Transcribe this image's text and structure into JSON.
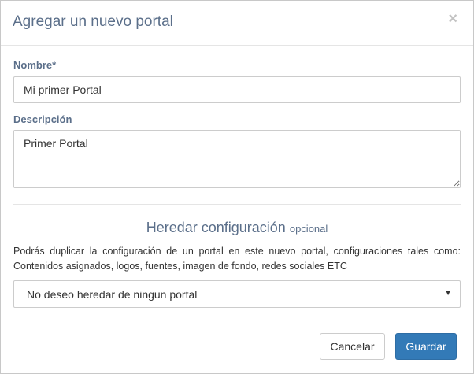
{
  "modal": {
    "title": "Agregar un nuevo portal",
    "close_symbol": "×"
  },
  "form": {
    "name_label": "Nombre*",
    "name_value": "Mi primer Portal",
    "description_label": "Descripción",
    "description_value": "Primer Portal"
  },
  "inherit": {
    "heading": "Heredar configuración",
    "optional_label": "opcional",
    "help_text": "Podrás duplicar la configuración de un portal en este nuevo portal, configuraciones tales como: Contenidos asignados, logos, fuentes, imagen de fondo, redes sociales ETC",
    "selected_option": "No deseo heredar de ningun portal",
    "arrow_symbol": "▼"
  },
  "footer": {
    "cancel_label": "Cancelar",
    "save_label": "Guardar"
  },
  "colors": {
    "primary": "#337ab7",
    "heading": "#5b6f8a"
  }
}
